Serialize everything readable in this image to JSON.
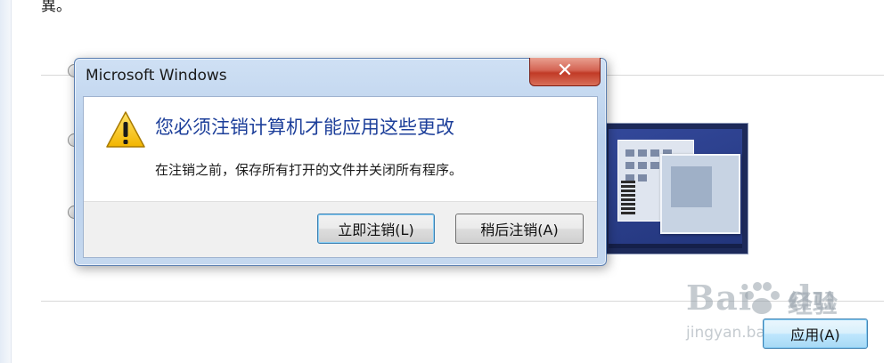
{
  "background": {
    "top_fragment": "異。",
    "apply_button_label": "应用(A)"
  },
  "dialog": {
    "title": "Microsoft Windows",
    "close_glyph": "✕",
    "main_instruction": "您必须注销计算机才能应用这些更改",
    "content_text": "在注销之前，保存所有打开的文件并关闭所有程序。",
    "buttons": {
      "log_off_now": "立即注销(L)",
      "log_off_later": "稍后注销(A)"
    },
    "icon": "warning-icon"
  },
  "watermark": {
    "logo_text": "Bai",
    "logo_text2": "du",
    "brand_cn": "经验",
    "url": "jingyan.baidu.com"
  },
  "colors": {
    "main_instruction": "#1d3f9a",
    "close_button": "#c13a26",
    "dialog_frame": "#b9d0ec"
  }
}
